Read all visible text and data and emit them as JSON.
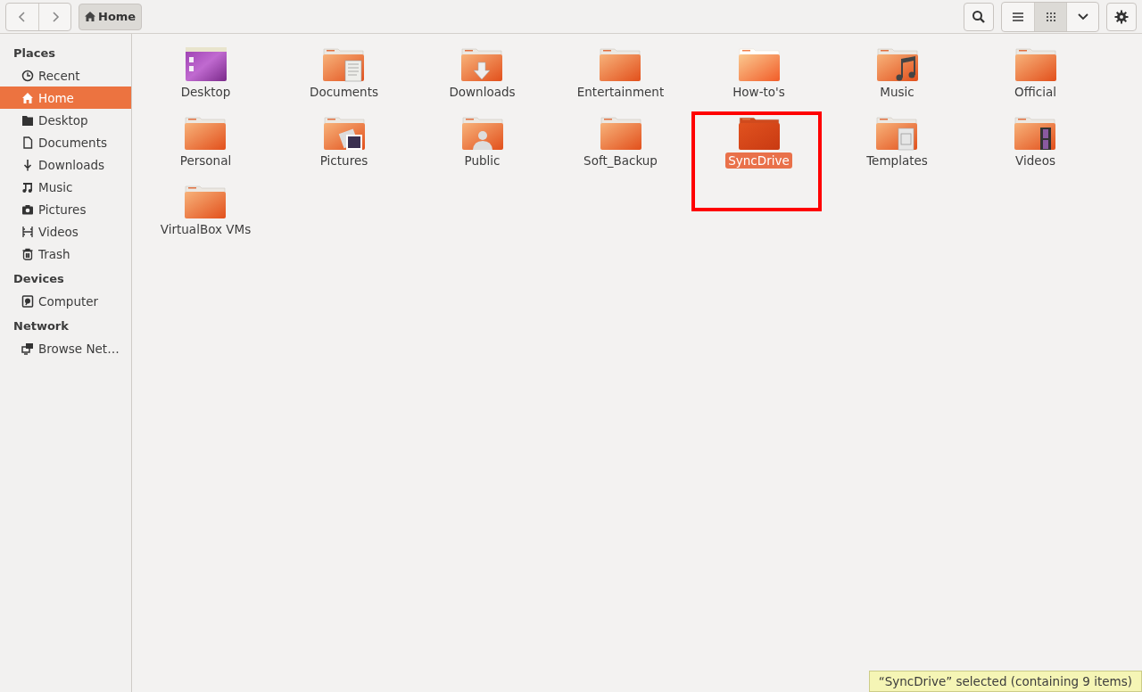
{
  "toolbar": {
    "path": [
      {
        "label": "Home",
        "selected": true
      }
    ],
    "view_buttons": [
      {
        "kind": "list",
        "selected": false
      },
      {
        "kind": "grid",
        "selected": true
      },
      {
        "kind": "menu",
        "selected": false
      }
    ]
  },
  "sidebar": {
    "sections": [
      {
        "title": "Places",
        "items": [
          {
            "label": "Recent",
            "kind": "recent",
            "selected": false
          },
          {
            "label": "Home",
            "kind": "home",
            "selected": true
          },
          {
            "label": "Desktop",
            "kind": "desktop",
            "selected": false
          },
          {
            "label": "Documents",
            "kind": "document",
            "selected": false
          },
          {
            "label": "Downloads",
            "kind": "download",
            "selected": false
          },
          {
            "label": "Music",
            "kind": "music",
            "selected": false
          },
          {
            "label": "Pictures",
            "kind": "camera",
            "selected": false
          },
          {
            "label": "Videos",
            "kind": "film",
            "selected": false
          },
          {
            "label": "Trash",
            "kind": "trash",
            "selected": false
          }
        ]
      },
      {
        "title": "Devices",
        "items": [
          {
            "label": "Computer",
            "kind": "drive",
            "selected": false
          }
        ]
      },
      {
        "title": "Network",
        "items": [
          {
            "label": "Browse Net…",
            "kind": "network",
            "selected": false
          }
        ]
      }
    ]
  },
  "files": [
    {
      "name": "Desktop",
      "kind": "desktop",
      "selected": false,
      "hovered": false,
      "marked": false
    },
    {
      "name": "Documents",
      "kind": "documents",
      "selected": false,
      "hovered": false,
      "marked": false
    },
    {
      "name": "Downloads",
      "kind": "downloads",
      "selected": false,
      "hovered": false,
      "marked": false
    },
    {
      "name": "Entertainment",
      "kind": "plain",
      "selected": false,
      "hovered": false,
      "marked": false
    },
    {
      "name": "How-to's",
      "kind": "plain",
      "selected": false,
      "hovered": true,
      "marked": false
    },
    {
      "name": "Music",
      "kind": "music",
      "selected": false,
      "hovered": false,
      "marked": false
    },
    {
      "name": "Official",
      "kind": "plain",
      "selected": false,
      "hovered": false,
      "marked": false
    },
    {
      "name": "Personal",
      "kind": "plain",
      "selected": false,
      "hovered": false,
      "marked": false
    },
    {
      "name": "Pictures",
      "kind": "pictures",
      "selected": false,
      "hovered": false,
      "marked": false
    },
    {
      "name": "Public",
      "kind": "public",
      "selected": false,
      "hovered": false,
      "marked": false
    },
    {
      "name": "Soft_Backup",
      "kind": "plain",
      "selected": false,
      "hovered": false,
      "marked": false
    },
    {
      "name": "SyncDrive",
      "kind": "plain",
      "selected": true,
      "hovered": false,
      "marked": true
    },
    {
      "name": "Templates",
      "kind": "templates",
      "selected": false,
      "hovered": false,
      "marked": false
    },
    {
      "name": "Videos",
      "kind": "videos",
      "selected": false,
      "hovered": false,
      "marked": false
    },
    {
      "name": "VirtualBox VMs",
      "kind": "plain",
      "selected": false,
      "hovered": false,
      "marked": false
    }
  ],
  "status": "“SyncDrive” selected  (containing 9 items)"
}
